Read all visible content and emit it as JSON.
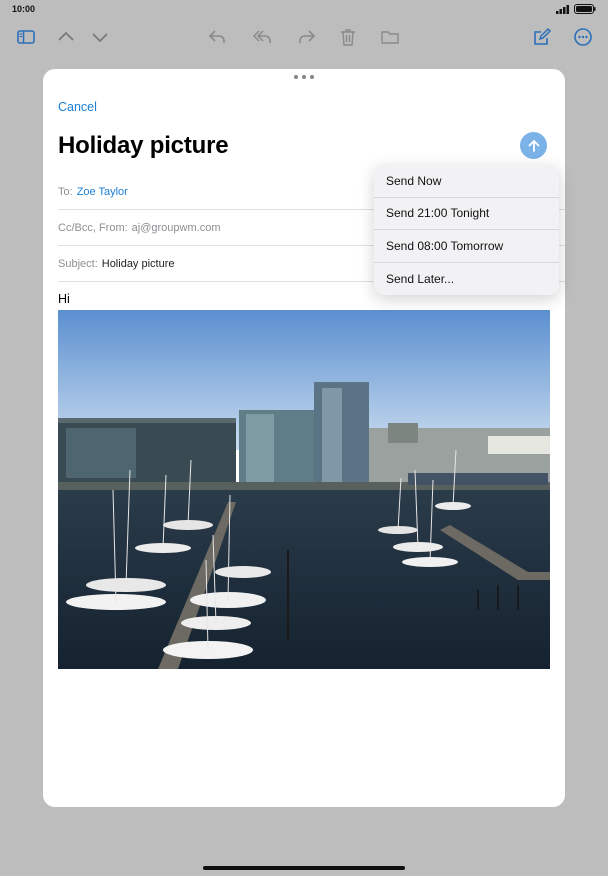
{
  "status": {
    "time": "10:00"
  },
  "toolbar": {
    "icons": [
      "sidebar-icon",
      "chevron-up-icon",
      "chevron-down-icon",
      "reply-icon",
      "reply-all-icon",
      "forward-icon",
      "trash-icon",
      "folder-icon",
      "compose-icon",
      "more-icon"
    ]
  },
  "compose": {
    "cancel_label": "Cancel",
    "title": "Holiday picture",
    "to_label": "To:",
    "to_value": "Zoe Taylor",
    "cc_label": "Cc/Bcc, From:",
    "cc_value": "aj@groupwm.com",
    "subject_label": "Subject:",
    "subject_value": "Holiday picture",
    "body_text": "Hi"
  },
  "send_menu": {
    "items": [
      "Send Now",
      "Send 21:00 Tonight",
      "Send 08:00 Tomorrow",
      "Send Later..."
    ]
  },
  "colors": {
    "accent": "#1a7fd4",
    "send_button": "#7bb2e8"
  }
}
